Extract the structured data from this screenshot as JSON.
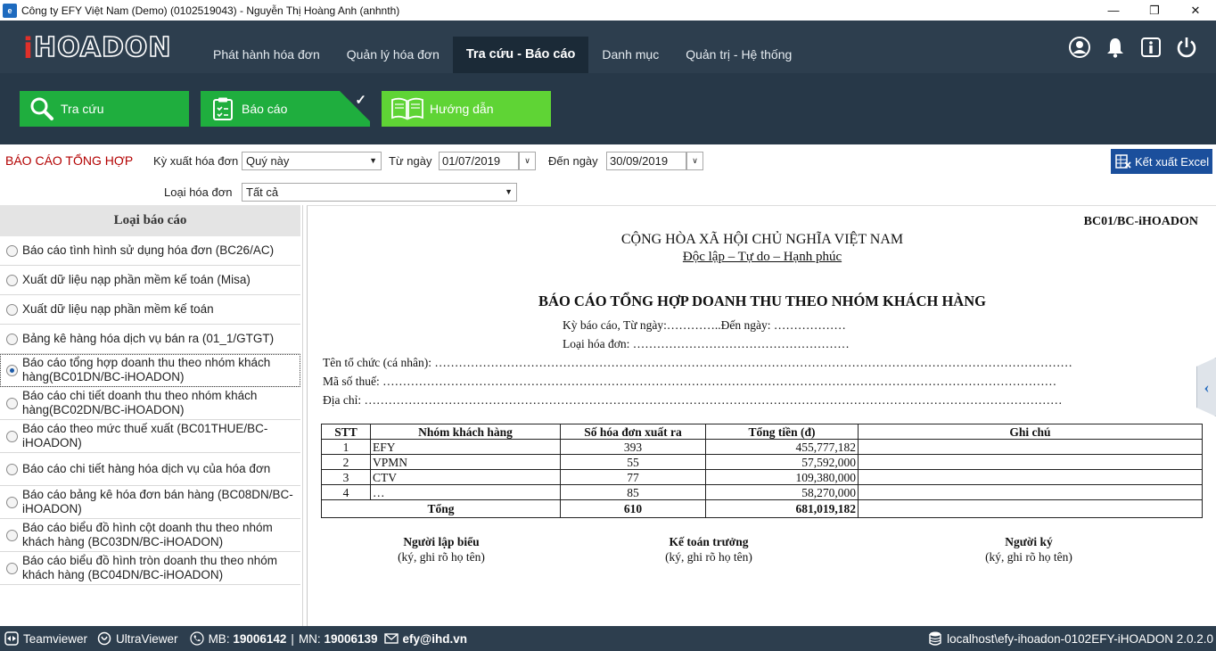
{
  "window": {
    "title": "Công ty EFY Việt Nam (Demo) (0102519043) - Nguyễn Thị Hoàng Anh (anhnth)",
    "controls": [
      "—",
      "❐",
      "✕"
    ]
  },
  "header": {
    "logo_i": "i",
    "logo_rest": "HOADON",
    "tabs": [
      {
        "label": "Phát hành hóa đơn"
      },
      {
        "label": "Quản lý hóa đơn"
      },
      {
        "label": "Tra cứu -  Báo cáo",
        "active": true
      },
      {
        "label": "Danh mục"
      },
      {
        "label": "Quản trị - Hệ thống"
      }
    ],
    "icons": [
      "user-icon",
      "bell-icon",
      "info-icon",
      "power-icon"
    ]
  },
  "toolbar": {
    "buttons": [
      {
        "label": "Tra cứu",
        "icon": "search-icon"
      },
      {
        "label": "Báo cáo",
        "icon": "clipboard-icon",
        "selected": true
      },
      {
        "label": "Hướng dẫn",
        "icon": "book-icon"
      }
    ]
  },
  "filters": {
    "section_title": "BÁO CÁO TỔNG HỢP",
    "period_label": "Kỳ xuất hóa đơn",
    "period_value": "Quý này",
    "from_label": "Từ ngày",
    "from_value": "01/07/2019",
    "to_label": "Đến ngày",
    "to_value": "30/09/2019",
    "type_label": "Loại hóa đơn",
    "type_value": "Tất cả",
    "export_label": "Kết xuất Excel"
  },
  "report_types": {
    "heading": "Loại báo cáo",
    "items": [
      {
        "label": "Báo cáo tình hình sử dụng hóa đơn (BC26/AC)"
      },
      {
        "label": "Xuất dữ liệu nạp phần mềm kế toán (Misa)"
      },
      {
        "label": "Xuất dữ liệu nạp phần mềm kế toán"
      },
      {
        "label": "Bảng kê hàng hóa dịch vụ bán ra (01_1/GTGT)"
      },
      {
        "label": "Báo cáo tổng hợp doanh thu theo nhóm khách hàng(BC01DN/BC-iHOADON)",
        "selected": true
      },
      {
        "label": "Báo cáo chi tiết doanh thu theo nhóm khách hàng(BC02DN/BC-iHOADON)"
      },
      {
        "label": "Báo cáo theo mức thuế xuất (BC01THUE/BC-iHOADON)"
      },
      {
        "label": "Báo cáo chi tiết hàng hóa dịch vụ của hóa đơn"
      },
      {
        "label": "Báo cáo bảng kê hóa đơn bán hàng (BC08DN/BC-iHOADON)"
      },
      {
        "label": "Báo cáo biểu đồ hình cột doanh thu theo nhóm khách hàng (BC03DN/BC-iHOADON)"
      },
      {
        "label": "Báo cáo biểu đồ hình tròn doanh thu theo nhóm khách hàng (BC04DN/BC-iHOADON)"
      }
    ]
  },
  "report": {
    "code": "BC01/BC-iHOADON",
    "nation": "CỘNG HÒA XÃ HỘI CHỦ NGHĨA VIỆT NAM",
    "motto": "Độc lập – Tự do – Hạnh phúc",
    "title": "BÁO CÁO TỔNG HỢP DOANH THU THEO NHÓM KHÁCH HÀNG",
    "period_line": "Kỳ báo cáo, Từ ngày:…………..Đến ngày: ………………",
    "type_line": "Loại hóa đơn: ………………………………………………",
    "org_line": "Tên tổ chức (cá nhân): ……………………………………………………………………………………………………………………………………………",
    "tax_line": "Mã số thuế: ……………………………………………………………………………………………………………………………………………………",
    "addr_line": "Địa chỉ: …………………………………………………………………………………………………………………………………………………………",
    "table": {
      "headers": [
        "STT",
        "Nhóm khách hàng",
        "Số hóa đơn xuất ra",
        "Tổng tiền (đ)",
        "Ghi chú"
      ],
      "rows": [
        [
          "1",
          "EFY",
          "393",
          "455,777,182",
          ""
        ],
        [
          "2",
          "VPMN",
          "55",
          "57,592,000",
          ""
        ],
        [
          "3",
          "CTV",
          "77",
          "109,380,000",
          ""
        ],
        [
          "4",
          "…",
          "85",
          "58,270,000",
          ""
        ]
      ],
      "total": {
        "label": "Tổng",
        "count": "610",
        "amount": "681,019,182"
      }
    },
    "signatures": [
      {
        "title": "Người lập biểu",
        "note": "(ký, ghi rõ họ tên)"
      },
      {
        "title": "Kế toán trưởng",
        "note": "(ký, ghi rõ họ tên)"
      },
      {
        "title": "Người ký",
        "note": "(ký, ghi rõ họ tên)"
      }
    ]
  },
  "statusbar": {
    "teamviewer": "Teamviewer",
    "ultraviewer": "UltraViewer",
    "mb_label": "MB:",
    "mb_value": "19006142",
    "sep": "|",
    "mn_label": "MN:",
    "mn_value": "19006139",
    "email": "efy@ihd.vn",
    "db": "localhost\\efy-ihoadon-0102EFY-iHOADON 2.0.2.0"
  }
}
